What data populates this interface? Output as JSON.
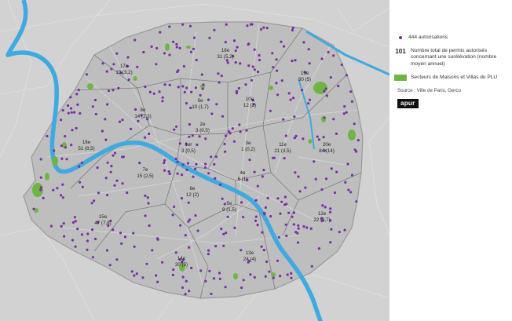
{
  "legend": {
    "authorisations": "444 autorisations",
    "total_number": "101",
    "total_text": "Nombre total de permis autorisés concernant une surélévation (nombre moyen annuel)",
    "zones_text": "Secteurs de Maisons et Villas du PLU",
    "source": "Source : Ville de Paris, Gerco",
    "logo": "apur"
  },
  "colors": {
    "dot": "#7a2ea6",
    "zone": "#6fb544",
    "river": "#3fa9e0",
    "land": "#cfcfcf",
    "paris": "#bdbdbd"
  },
  "arrondissements": [
    {
      "id": "arr-1",
      "num": "1er",
      "val": "3 (0,5)"
    },
    {
      "id": "arr-2",
      "num": "2e",
      "val": "3 (0,5)"
    },
    {
      "id": "arr-3",
      "num": "3e",
      "val": "1 (0,2)"
    },
    {
      "id": "arr-4",
      "num": "4e",
      "val": "6 (1)"
    },
    {
      "id": "arr-5",
      "num": "5e",
      "val": "9 (1,5)"
    },
    {
      "id": "arr-6",
      "num": "6e",
      "val": "12 (2)"
    },
    {
      "id": "arr-7",
      "num": "7e",
      "val": "15 (2,5)"
    },
    {
      "id": "arr-8",
      "num": "8e",
      "val": "14 (2,3)"
    },
    {
      "id": "arr-9",
      "num": "9e",
      "val": "10 (1,7)"
    },
    {
      "id": "arr-10",
      "num": "10e",
      "val": "12 (2)"
    },
    {
      "id": "arr-11",
      "num": "11e",
      "val": "21 (3,5)"
    },
    {
      "id": "arr-12",
      "num": "12e",
      "val": "22 (3,7)"
    },
    {
      "id": "arr-13",
      "num": "13e",
      "val": "24 (4)"
    },
    {
      "id": "arr-14",
      "num": "14e",
      "val": "30 (5)"
    },
    {
      "id": "arr-15",
      "num": "15e",
      "val": "47 (7,8)"
    },
    {
      "id": "arr-16",
      "num": "16e",
      "val": "51 (8,5)"
    },
    {
      "id": "arr-17",
      "num": "17e",
      "val": "19 (3,2)"
    },
    {
      "id": "arr-18",
      "num": "18e",
      "val": "31 (5,2)"
    },
    {
      "id": "arr-19",
      "num": "19e",
      "val": "30 (5)"
    },
    {
      "id": "arr-20",
      "num": "20e",
      "val": "84 (14)"
    }
  ]
}
